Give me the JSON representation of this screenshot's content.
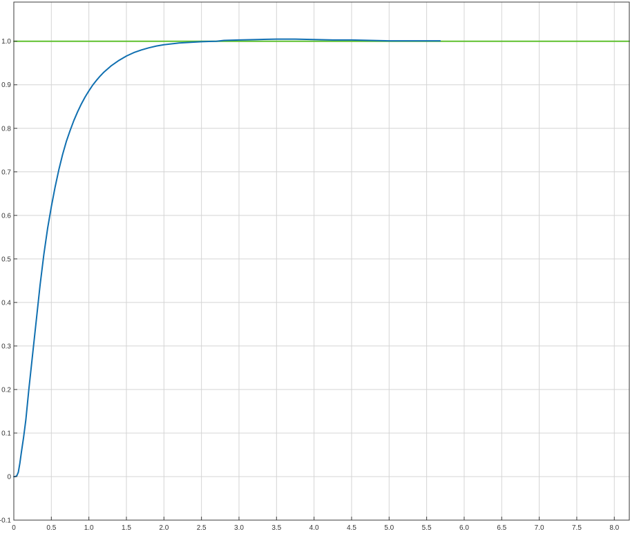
{
  "chart_data": {
    "type": "line",
    "title": "",
    "xlabel": "",
    "ylabel": "",
    "xlim": [
      0,
      8.2
    ],
    "ylim": [
      -0.1,
      1.09
    ],
    "grid": true,
    "legend": "none",
    "x_ticks": [
      0,
      0.5,
      1.0,
      1.5,
      2.0,
      2.5,
      3.0,
      3.5,
      4.0,
      4.5,
      5.0,
      5.5,
      6.0,
      6.5,
      7.0,
      7.5,
      8.0
    ],
    "x_tick_labels": [
      "0",
      "0.5",
      "1.0",
      "1.5",
      "2.0",
      "2.5",
      "3.0",
      "3.5",
      "4.0",
      "4.5",
      "5.0",
      "5.5",
      "6.0",
      "6.5",
      "7.0",
      "7.5",
      "8.0"
    ],
    "y_ticks": [
      -0.1,
      0,
      0.1,
      0.2,
      0.3,
      0.4,
      0.5,
      0.6,
      0.7,
      0.8,
      0.9,
      1.0
    ],
    "y_tick_labels": [
      "-0.1",
      "0",
      "0.1",
      "0.2",
      "0.3",
      "0.4",
      "0.5",
      "0.6",
      "0.7",
      "0.8",
      "0.9",
      "1.0"
    ],
    "series": [
      {
        "color": "#0f6fb0",
        "x": [
          0,
          0.02,
          0.04,
          0.06,
          0.08,
          0.1,
          0.13,
          0.16,
          0.2,
          0.25,
          0.3,
          0.35,
          0.4,
          0.45,
          0.5,
          0.55,
          0.6,
          0.65,
          0.7,
          0.75,
          0.8,
          0.85,
          0.9,
          0.95,
          1.0,
          1.05,
          1.1,
          1.15,
          1.2,
          1.3,
          1.4,
          1.5,
          1.6,
          1.7,
          1.8,
          1.9,
          2.0,
          2.1,
          2.2,
          2.3,
          2.4,
          2.5,
          2.6,
          2.7,
          2.8,
          3.0,
          3.25,
          3.5,
          3.75,
          4.0,
          4.25,
          4.5,
          4.75,
          5.0,
          5.25,
          5.5,
          5.68
        ],
        "y": [
          0,
          0,
          0.002,
          0.01,
          0.03,
          0.055,
          0.09,
          0.13,
          0.2,
          0.28,
          0.36,
          0.44,
          0.51,
          0.57,
          0.62,
          0.665,
          0.705,
          0.74,
          0.77,
          0.795,
          0.818,
          0.838,
          0.856,
          0.872,
          0.886,
          0.899,
          0.91,
          0.92,
          0.929,
          0.944,
          0.956,
          0.966,
          0.974,
          0.98,
          0.985,
          0.989,
          0.992,
          0.994,
          0.996,
          0.997,
          0.998,
          0.999,
          0.9995,
          1.0,
          1.002,
          1.003,
          1.004,
          1.005,
          1.005,
          1.004,
          1.003,
          1.003,
          1.002,
          1.001,
          1.001,
          1.001,
          1.001
        ]
      },
      {
        "color": "#5fc02e",
        "x": [
          0,
          8.2
        ],
        "y": [
          1.0,
          1.0
        ]
      }
    ]
  }
}
